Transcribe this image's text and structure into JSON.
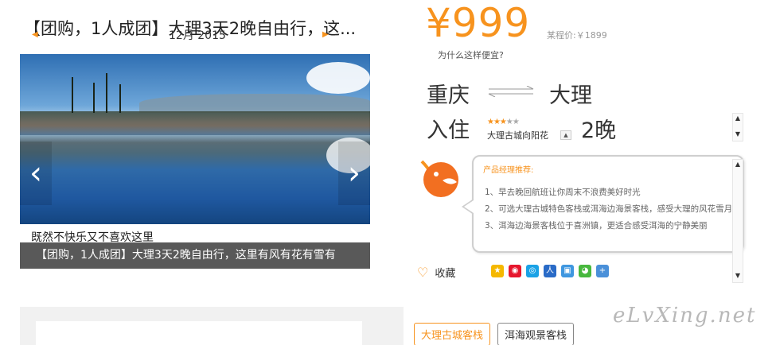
{
  "product": {
    "title": "【团购，1人成团】大理3天2晚自由行，这...",
    "price": "¥999",
    "orig_price": "某程价:￥1899",
    "why_cheap": "为什么这样便宜?"
  },
  "gallery": {
    "caption_hand": "既然不快乐又不喜欢这里",
    "caption_bar": "【团购，1人成团】大理3天2晚自由行，这里有风有花有雪有"
  },
  "route": {
    "from": "重庆",
    "to": "大理"
  },
  "stay": {
    "label": "入住",
    "hotel_name": "大理古城向阳花",
    "stars_on": "★★★",
    "stars_off": "★★",
    "nights": "2晚"
  },
  "manager": {
    "title": "产品经理推荐:",
    "points": [
      "1、早去晚回航班让你周末不浪费美好时光",
      "2、可选大理古城特色客栈或洱海边海景客栈，感受大理的风花雪月",
      "3、洱海边海景客栈位于喜洲镇，更适合感受洱海的宁静美丽"
    ]
  },
  "actions": {
    "favorite": "收藏"
  },
  "calendar": {
    "month": "12月 2015"
  },
  "tags": [
    "大理古城客栈",
    "洱海观景客栈"
  ],
  "watermark": "eLvXing.net",
  "colors": {
    "accent": "#f7931e"
  }
}
